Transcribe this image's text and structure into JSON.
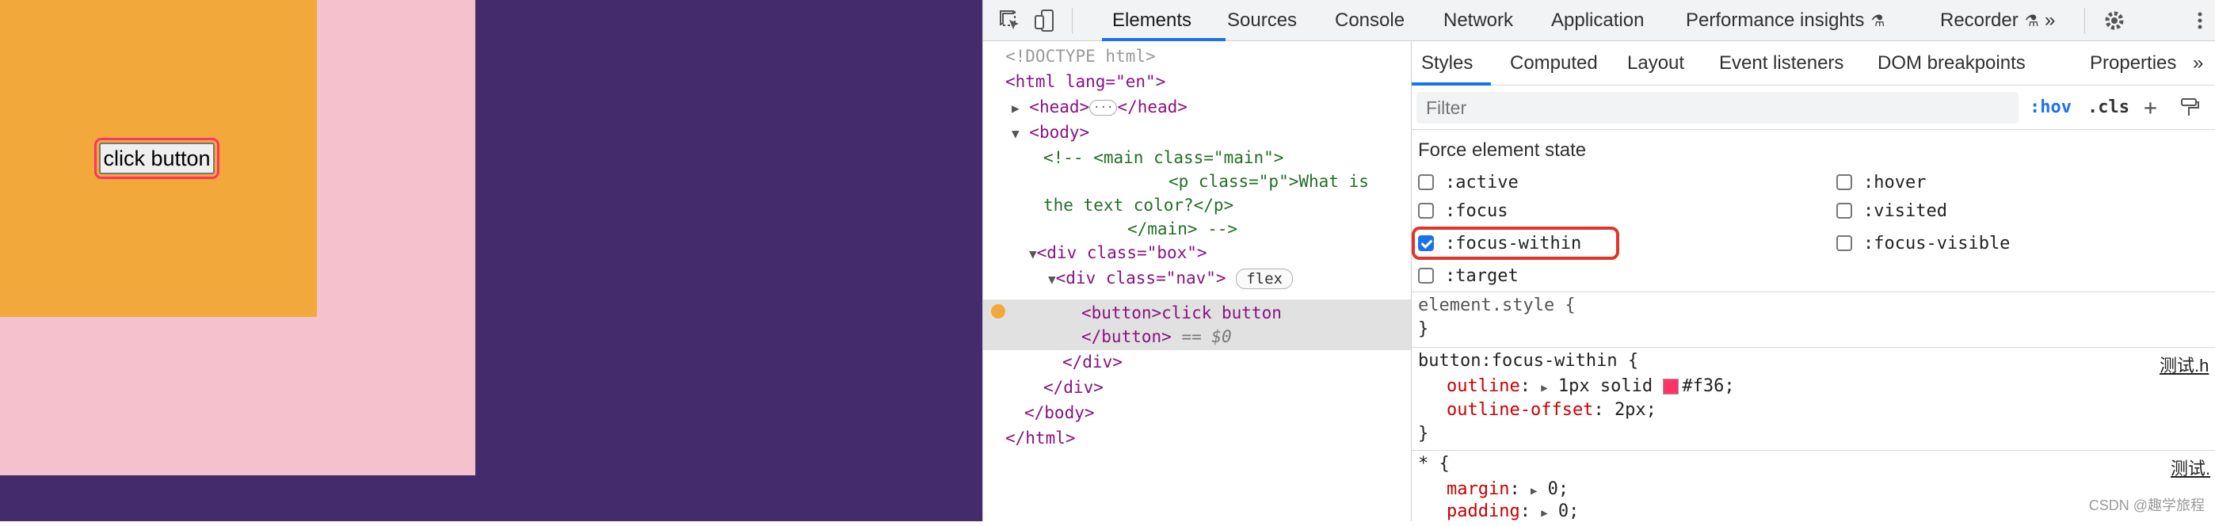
{
  "page": {
    "button_label": "click button",
    "colors": {
      "outer": "#442b6c",
      "box": "#f5c1cd",
      "nav": "#f2a83b",
      "outline": "#ff3366"
    }
  },
  "devtools": {
    "main_tabs": [
      "Elements",
      "Sources",
      "Console",
      "Network",
      "Application",
      "Performance insights",
      "Recorder"
    ],
    "overflow_label": "»",
    "elements": {
      "doctype": "<!DOCTYPE html>",
      "html_open": "<html lang=\"en\">",
      "head": "<head>",
      "head_close": "</head>",
      "body_open": "<body>",
      "comment_1": "<!-- <main class=\"main\">",
      "comment_2": "<p class=\"p\">What is",
      "comment_3": "the text color?</p>",
      "comment_4": "</main> -->",
      "div_box": "<div class=\"box\">",
      "div_nav": "<div class=\"nav\">",
      "flex_badge": "flex",
      "button_open": "<button>click button",
      "button_close": "</button>",
      "dollar0": "== $0",
      "div_close_1": "</div>",
      "div_close_2": "</div>",
      "body_close": "</body>",
      "html_close": "</html>"
    },
    "styles": {
      "subtabs": [
        "Styles",
        "Computed",
        "Layout",
        "Event listeners",
        "DOM breakpoints",
        "Properties"
      ],
      "subtab_overflow": "»",
      "filter_placeholder": "Filter",
      "hov": ":hov",
      "cls": ".cls",
      "force_title": "Force element state",
      "states_left": [
        {
          "label": ":active",
          "checked": false
        },
        {
          "label": ":focus",
          "checked": false
        },
        {
          "label": ":focus-within",
          "checked": true
        },
        {
          "label": ":target",
          "checked": false
        }
      ],
      "states_right": [
        {
          "label": ":hover",
          "checked": false
        },
        {
          "label": ":visited",
          "checked": false
        },
        {
          "label": ":focus-visible",
          "checked": false
        }
      ],
      "element_style_open": "element.style {",
      "close_brace": "}",
      "rule1_selector": "button:focus-within {",
      "rule1_source": "测试.h",
      "rule1_props": [
        {
          "name": "outline",
          "value": "1px solid",
          "color": "#f36"
        },
        {
          "name": "outline-offset",
          "value": "2px;"
        }
      ],
      "rule2_selector": "* {",
      "rule2_source": "测试.",
      "rule2_props": [
        {
          "name": "margin",
          "value": "0;"
        },
        {
          "name": "padding",
          "value": "0;"
        }
      ]
    }
  },
  "watermark": "CSDN @趣学旅程"
}
